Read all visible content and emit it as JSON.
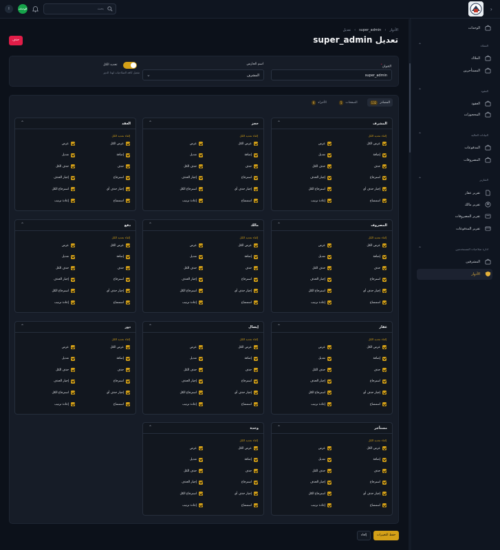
{
  "topbar": {
    "search_placeholder": "بحث",
    "brand_badge": "الوحدات",
    "avatar_initial": "ا"
  },
  "sidebar": {
    "items": [
      {
        "type": "item",
        "label": "الوحدات",
        "icon": "building-icon"
      },
      {
        "type": "group",
        "label": "العملاء"
      },
      {
        "type": "item",
        "label": "الملاك",
        "icon": "building-icon"
      },
      {
        "type": "item",
        "label": "المستأجرين",
        "icon": "building-icon"
      },
      {
        "type": "group",
        "label": "العقود"
      },
      {
        "type": "item",
        "label": "العقود",
        "icon": "building-icon"
      },
      {
        "type": "item",
        "label": "المحجوزات",
        "icon": "building-icon"
      },
      {
        "type": "group",
        "label": "البيانات المالية"
      },
      {
        "type": "item",
        "label": "المدفوعات",
        "icon": "building-icon"
      },
      {
        "type": "item",
        "label": "المصروفات",
        "icon": "building-icon"
      },
      {
        "type": "group",
        "label": "التقارير"
      },
      {
        "type": "item",
        "label": "تقرير عقار",
        "icon": "document-icon"
      },
      {
        "type": "item",
        "label": "تقرير مالك",
        "icon": "user-circle-icon"
      },
      {
        "type": "item",
        "label": "تقرير المصروفات",
        "icon": "receipt-icon"
      },
      {
        "type": "item",
        "label": "تقرير المدفوعات",
        "icon": "card-icon"
      },
      {
        "type": "group",
        "label": "ادارة صلاحيات المستخدمين"
      },
      {
        "type": "item",
        "label": "المشرفين",
        "icon": "building-icon"
      },
      {
        "type": "item",
        "label": "الأدوار",
        "icon": "shield-icon",
        "active": true
      }
    ]
  },
  "breadcrumb": [
    "الأدوار",
    "super_admin",
    "تعديل"
  ],
  "page_title": "تعديل super_admin",
  "delete_label": "حذف",
  "form": {
    "name_label": "العنوان",
    "name_value": "super_admin",
    "guard_label": "اسم الحارس",
    "guard_value": "المشرف",
    "select_all_label": "تحديد الكل",
    "select_all_hint": "تفعيل كافة الصلاحيات لهذا الدور"
  },
  "tabs": [
    {
      "label": "المصادر",
      "count": "132",
      "active": true
    },
    {
      "label": "الصفحات",
      "count": "5",
      "active": false
    },
    {
      "label": "الأجزاء",
      "count": "6",
      "active": false
    }
  ],
  "deselect_all_label": "إلغاء تحديد الكل",
  "resources": [
    {
      "title": "المشرف",
      "perms": [
        "عرض الكل",
        "عرض",
        "إضافة",
        "تعديل",
        "حذف",
        "حذف الكل",
        "استرجاع",
        "إجبار الحذف",
        "إجبار حذف أي",
        "استرجاع الكل",
        "استنساخ",
        "إعادة ترتيب"
      ]
    },
    {
      "title": "حجز",
      "perms": [
        "عرض الكل",
        "عرض",
        "إضافة",
        "تعديل",
        "حذف",
        "حذف الكل",
        "استرجاع",
        "إجبار الحذف",
        "إجبار حذف أي",
        "استرجاع الكل",
        "استنساخ",
        "إعادة ترتيب"
      ]
    },
    {
      "title": "العقد",
      "perms": [
        "عرض الكل",
        "عرض",
        "إضافة",
        "تعديل",
        "حذف",
        "حذف الكل",
        "استرجاع",
        "إجبار الحذف",
        "إجبار حذف أي",
        "استرجاع الكل",
        "استنساخ",
        "إعادة ترتيب"
      ]
    },
    {
      "title": "المصروف",
      "perms": [
        "عرض الكل",
        "عرض",
        "إضافة",
        "تعديل",
        "حذف",
        "حذف الكل",
        "استرجاع",
        "إجبار الحذف",
        "إجبار حذف أي",
        "استرجاع الكل",
        "استنساخ",
        "إعادة ترتيب"
      ]
    },
    {
      "title": "مالك",
      "perms": [
        "عرض الكل",
        "عرض",
        "إضافة",
        "تعديل",
        "حذف",
        "حذف الكل",
        "استرجاع",
        "إجبار الحذف",
        "إجبار حذف أي",
        "استرجاع الكل",
        "استنساخ",
        "إعادة ترتيب"
      ]
    },
    {
      "title": "دفع",
      "perms": [
        "عرض الكل",
        "عرض",
        "إضافة",
        "تعديل",
        "حذف",
        "حذف الكل",
        "استرجاع",
        "إجبار الحذف",
        "إجبار حذف أي",
        "استرجاع الكل",
        "استنساخ",
        "إعادة ترتيب"
      ]
    },
    {
      "title": "عقار",
      "perms": [
        "عرض الكل",
        "عرض",
        "إضافة",
        "تعديل",
        "حذف",
        "حذف الكل",
        "استرجاع",
        "إجبار الحذف",
        "إجبار حذف أي",
        "استرجاع الكل",
        "استنساخ",
        "إعادة ترتيب"
      ]
    },
    {
      "title": "إيصال",
      "perms": [
        "عرض الكل",
        "عرض",
        "إضافة",
        "تعديل",
        "حذف",
        "حذف الكل",
        "استرجاع",
        "إجبار الحذف",
        "إجبار حذف أي",
        "استرجاع الكل",
        "استنساخ",
        "إعادة ترتيب"
      ]
    },
    {
      "title": "دور",
      "perms": [
        "عرض الكل",
        "عرض",
        "إضافة",
        "تعديل",
        "حذف",
        "حذف الكل",
        "استرجاع",
        "إجبار الحذف",
        "إجبار حذف أي",
        "استرجاع الكل",
        "استنساخ",
        "إعادة ترتيب"
      ]
    },
    {
      "title": "مستأجر",
      "perms": [
        "عرض الكل",
        "عرض",
        "إضافة",
        "تعديل",
        "حذف",
        "حذف الكل",
        "استرجاع",
        "إجبار الحذف",
        "إجبار حذف أي",
        "استرجاع الكل",
        "استنساخ",
        "إعادة ترتيب"
      ]
    },
    {
      "title": "وحدة",
      "perms": [
        "عرض الكل",
        "عرض",
        "إضافة",
        "تعديل",
        "حذف",
        "حذف الكل",
        "استرجاع",
        "إجبار الحذف",
        "إجبار حذف أي",
        "استرجاع الكل",
        "استنساخ",
        "إعادة ترتيب"
      ]
    }
  ],
  "save_label": "حفظ التغييرات",
  "cancel_label": "إلغاء"
}
